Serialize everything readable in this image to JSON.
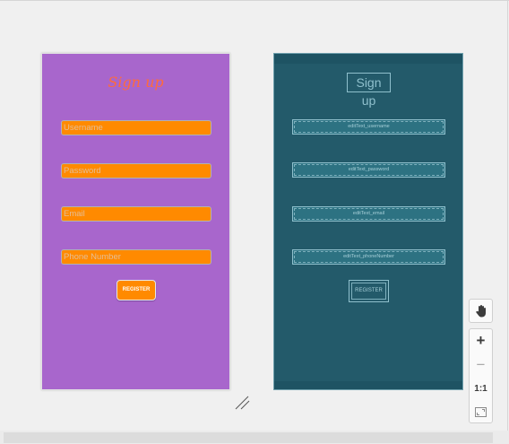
{
  "design": {
    "title": "Sign up",
    "fields": [
      {
        "hint": "Username"
      },
      {
        "hint": "Password"
      },
      {
        "hint": "Email"
      },
      {
        "hint": "Phone Number"
      }
    ],
    "button": "REGISTER",
    "colors": {
      "background": "#a866cc",
      "field": "#ff8a00",
      "title": "#ff6a3d"
    }
  },
  "blueprint": {
    "title": "Sign up",
    "fields": [
      {
        "id": "editText_username"
      },
      {
        "id": "editText_password"
      },
      {
        "id": "editText_email"
      },
      {
        "id": "editText_phoneNumber"
      }
    ],
    "button": "REGISTER",
    "colors": {
      "background": "#235a6a",
      "outline": "#8fc0cd"
    }
  },
  "zoom_toolbar": {
    "pan_icon": "hand-icon",
    "zoom_in": "+",
    "zoom_out": "−",
    "actual_size": "1:1",
    "fit_icon": "fit-screen-icon"
  }
}
